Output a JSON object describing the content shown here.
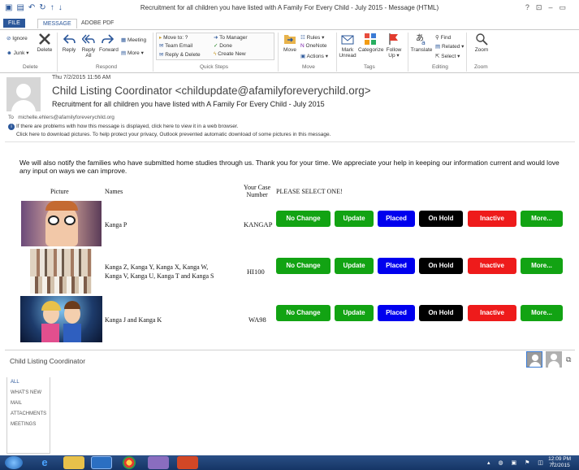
{
  "window": {
    "title": "Recruitment for all children you have listed with A Family For Every Child - July 2015 - Message (HTML)",
    "controls": [
      "?",
      "⊡",
      "–",
      "▭"
    ]
  },
  "tabs": [
    {
      "label": "FILE"
    },
    {
      "label": "MESSAGE"
    },
    {
      "label": "ADOBE PDF"
    }
  ],
  "ribbon": {
    "delete_group": {
      "ignore": "Ignore",
      "junk": "Junk ▾",
      "delete": "Delete",
      "label": "Delete"
    },
    "respond_group": {
      "reply": "Reply",
      "reply_all_1": "Reply",
      "reply_all_2": "All",
      "forward": "Forward",
      "meeting": "Meeting",
      "more": "More ▾",
      "label": "Respond"
    },
    "quick_steps": {
      "move_to": "Move to: ?",
      "team_email": "Team Email",
      "reply_delete": "Reply & Delete",
      "to_manager": "To Manager",
      "done": "Done",
      "create_new": "Create New",
      "label": "Quick Steps"
    },
    "move_group": {
      "move": "Move",
      "rules": "Rules ▾",
      "onenote": "OneNote",
      "actions": "Actions ▾",
      "label": "Move"
    },
    "tags_group": {
      "mark_unread_1": "Mark",
      "mark_unread_2": "Unread",
      "categorize": "Categorize",
      "follow_up_1": "Follow",
      "follow_up_2": "Up ▾",
      "label": "Tags"
    },
    "editing_group": {
      "translate": "Translate",
      "find": "Find",
      "related": "Related ▾",
      "select": "Select ▾",
      "label": "Editing"
    },
    "zoom_group": {
      "zoom": "Zoom",
      "label": "Zoom"
    }
  },
  "message": {
    "date": "Thu 7/2/2015 11:56 AM",
    "from": "Child Listing Coordinator <childupdate@afamilyforeverychild.org>",
    "subject": "Recruitment for all children you have listed with A Family For Every Child - July 2015",
    "to_label": "To",
    "to": "michelle.ehlers@afamilyforeverychild.org",
    "info_line_1": "If there are problems with how this message is displayed, click here to view it in a web browser.",
    "info_line_2": "Click here to download pictures. To help protect your privacy, Outlook prevented automatic download of some pictures in this message."
  },
  "body": {
    "intro": "We will also notify the families who have submitted home studies through us. Thank you for your time. We appreciate your help in keeping our information current and would love any input on ways we can improve.",
    "headers": {
      "picture": "Picture",
      "names": "Names",
      "case_1": "Your Case",
      "case_2": "Number",
      "select": "PLEASE SELECT ONE!"
    },
    "rows": [
      {
        "names": "Kanga P",
        "case": "KANGAP"
      },
      {
        "names_1": "Kanga Z, Kanga Y, Kanga X, Kanga W,",
        "names_2": "Kanga V, Kanga U, Kanga T and Kanga S",
        "case": "HI100"
      },
      {
        "names": "Kanga J and Kanga K",
        "case": "WA98"
      }
    ],
    "buttons": [
      {
        "label": "No Change",
        "color": "#12a313"
      },
      {
        "label": "Update",
        "color": "#12a313"
      },
      {
        "label": "Placed",
        "color": "#0000ee"
      },
      {
        "label": "On Hold",
        "color": "#000000"
      },
      {
        "label": "Inactive",
        "color": "#ee1b1b"
      },
      {
        "label": "More...",
        "color": "#12a313"
      }
    ]
  },
  "people_pane": {
    "name": "Child Listing Coordinator",
    "nav": [
      "ALL",
      "WHAT'S NEW",
      "MAIL",
      "ATTACHMENTS",
      "MEETINGS"
    ]
  },
  "taskbar": {
    "time": "12:09 PM",
    "date": "7/2/2015"
  }
}
